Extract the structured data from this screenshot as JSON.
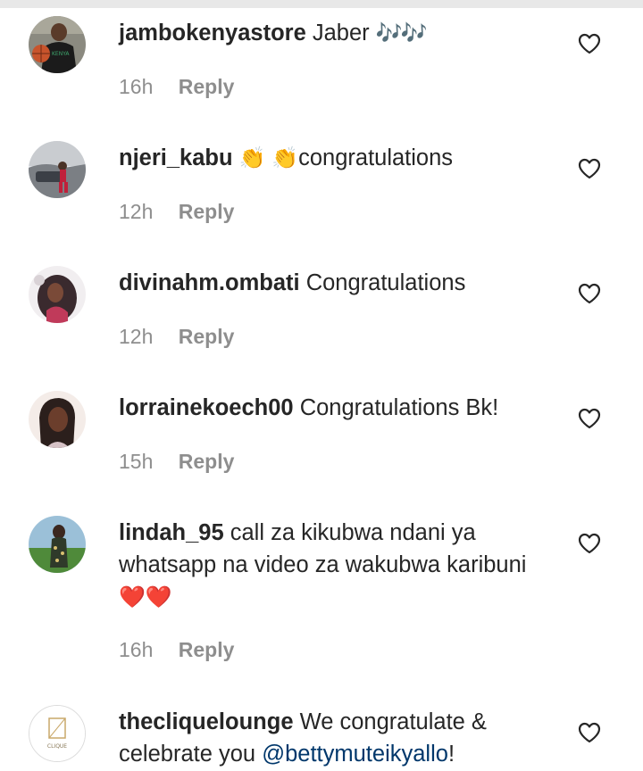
{
  "comments": [
    {
      "username": "jambokenyastore",
      "text": "Jaber",
      "emoji": "🎶🎶",
      "time": "16h",
      "reply": "Reply"
    },
    {
      "username": "njeri_kabu",
      "text": "congratulations",
      "emoji": "👏 👏",
      "time": "12h",
      "reply": "Reply"
    },
    {
      "username": "divinahm.ombati",
      "text": "Congratulations",
      "time": "12h",
      "reply": "Reply"
    },
    {
      "username": "lorrainekoech00",
      "text": "Congratulations Bk!",
      "time": "15h",
      "reply": "Reply"
    },
    {
      "username": "lindah_95",
      "text": "call za kikubwa ndani ya whatsapp na video za wakubwa karibuni",
      "emoji": "❤️❤️",
      "time": "16h",
      "reply": "Reply"
    },
    {
      "username": "thecliquelounge",
      "text": "We congratulate & celebrate you",
      "mention": "@bettymuteikyallo",
      "suffix": "!",
      "logo_text": "CLIQUE"
    }
  ],
  "colors": {
    "text": "#262626",
    "meta": "#8e8e8e",
    "mention": "#00376b",
    "heart_outline": "#262626"
  },
  "icons": {
    "like": "heart-outline-icon"
  }
}
